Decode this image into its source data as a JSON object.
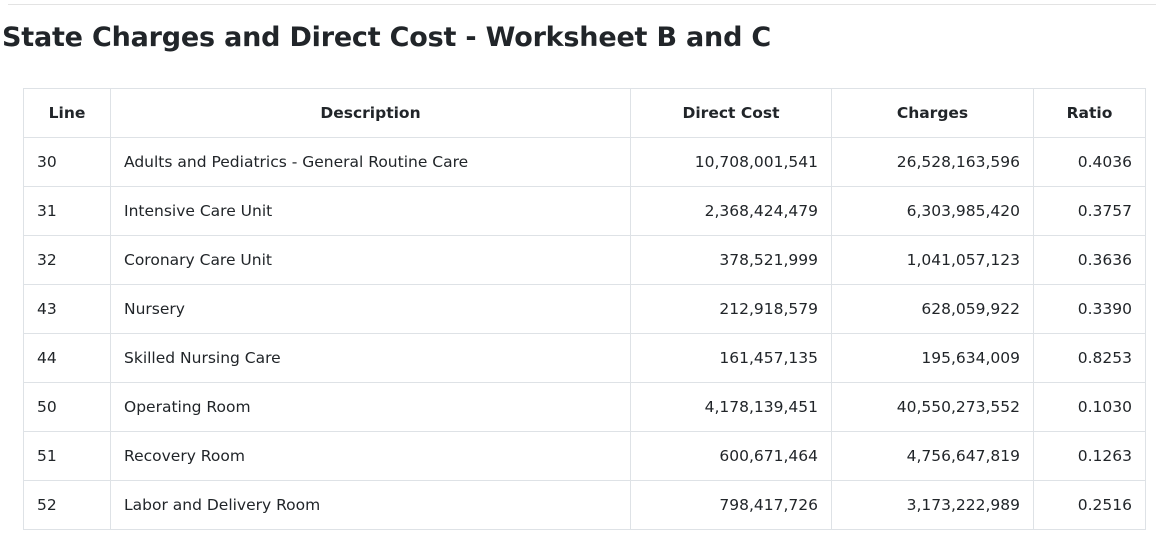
{
  "page": {
    "title": "State Charges and Direct Cost - Worksheet B and C"
  },
  "table": {
    "columns": [
      "Line",
      "Description",
      "Direct Cost",
      "Charges",
      "Ratio"
    ],
    "rows": [
      {
        "line": "30",
        "description": "Adults and Pediatrics - General Routine Care",
        "direct_cost": "10,708,001,541",
        "charges": "26,528,163,596",
        "ratio": "0.4036"
      },
      {
        "line": "31",
        "description": "Intensive Care Unit",
        "direct_cost": "2,368,424,479",
        "charges": "6,303,985,420",
        "ratio": "0.3757"
      },
      {
        "line": "32",
        "description": "Coronary Care Unit",
        "direct_cost": "378,521,999",
        "charges": "1,041,057,123",
        "ratio": "0.3636"
      },
      {
        "line": "43",
        "description": "Nursery",
        "direct_cost": "212,918,579",
        "charges": "628,059,922",
        "ratio": "0.3390"
      },
      {
        "line": "44",
        "description": "Skilled Nursing Care",
        "direct_cost": "161,457,135",
        "charges": "195,634,009",
        "ratio": "0.8253"
      },
      {
        "line": "50",
        "description": "Operating Room",
        "direct_cost": "4,178,139,451",
        "charges": "40,550,273,552",
        "ratio": "0.1030"
      },
      {
        "line": "51",
        "description": "Recovery Room",
        "direct_cost": "600,671,464",
        "charges": "4,756,647,819",
        "ratio": "0.1263"
      },
      {
        "line": "52",
        "description": "Labor and Delivery Room",
        "direct_cost": "798,417,726",
        "charges": "3,173,222,989",
        "ratio": "0.2516"
      }
    ]
  }
}
